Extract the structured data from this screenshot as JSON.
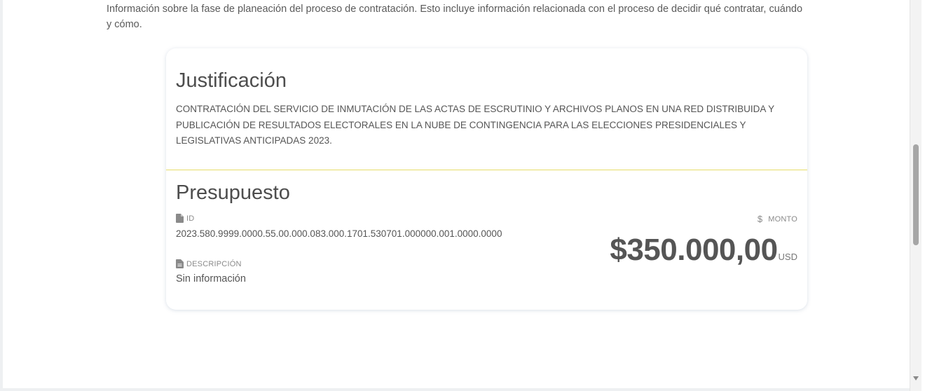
{
  "intro": {
    "text": "Información sobre la fase de planeación del proceso de contratación. Esto incluye información relacionada con el proceso de decidir qué contratar, cuándo y cómo."
  },
  "justificacion": {
    "title": "Justificación",
    "text": "CONTRATACIÓN DEL SERVICIO DE INMUTACIÓN DE LAS ACTAS DE ESCRUTINIO Y ARCHIVOS PLANOS EN UNA RED DISTRIBUIDA Y PUBLICACIÓN DE RESULTADOS ELECTORALES EN LA NUBE DE CONTINGENCIA PARA LAS ELECCIONES PRESIDENCIALES Y LEGISLATIVAS ANTICIPADAS 2023."
  },
  "presupuesto": {
    "title": "Presupuesto",
    "id_label": "ID",
    "id_value": "2023.580.9999.0000.55.00.000.083.000.1701.530701.000000.001.0000.0000",
    "description_label": "DESCRIPCIÓN",
    "description_value": "Sin información",
    "amount_label": "MONTO",
    "amount_icon": "$",
    "amount_value": "$350.000,00",
    "currency": "USD"
  },
  "colors": {
    "divider": "#e6dc6a",
    "text": "#555555"
  }
}
